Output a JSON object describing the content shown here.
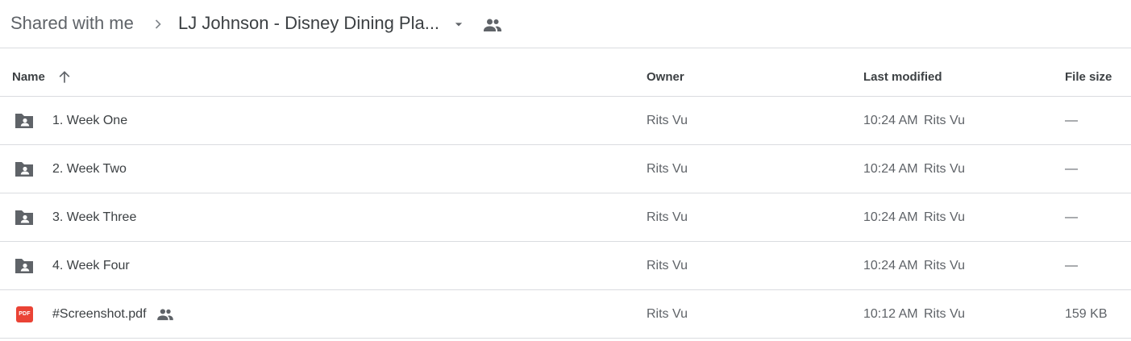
{
  "breadcrumb": {
    "root": "Shared with me",
    "current": "LJ Johnson - Disney Dining Pla..."
  },
  "table": {
    "columns": {
      "name": "Name",
      "owner": "Owner",
      "last_modified": "Last modified",
      "file_size": "File size"
    },
    "rows": [
      {
        "name": "1. Week One",
        "type": "shared-folder",
        "owner": "Rits Vu",
        "modified_time": "10:24 AM",
        "modified_by": "Rits Vu",
        "size": "—"
      },
      {
        "name": "2. Week Two",
        "type": "shared-folder",
        "owner": "Rits Vu",
        "modified_time": "10:24 AM",
        "modified_by": "Rits Vu",
        "size": "—"
      },
      {
        "name": "3. Week Three",
        "type": "shared-folder",
        "owner": "Rits Vu",
        "modified_time": "10:24 AM",
        "modified_by": "Rits Vu",
        "size": "—"
      },
      {
        "name": "4. Week Four",
        "type": "shared-folder",
        "owner": "Rits Vu",
        "modified_time": "10:24 AM",
        "modified_by": "Rits Vu",
        "size": "—"
      },
      {
        "name": "#Screenshot.pdf",
        "type": "pdf",
        "badge": "PDF",
        "owner": "Rits Vu",
        "modified_time": "10:12 AM",
        "modified_by": "Rits Vu",
        "size": "159 KB"
      }
    ]
  },
  "icons": {
    "separator": "chevron-right-icon",
    "dropdown": "arrow-drop-down-icon",
    "shared": "people-icon",
    "sort": "arrow-upward-icon",
    "folder": "shared-folder-icon",
    "pdf": "pdf-file-icon"
  },
  "colors": {
    "text": "#3c4043",
    "secondary_text": "#5f6368",
    "divider": "#dadce0",
    "folder_icon": "#5f6368",
    "pdf_red": "#ea4335"
  }
}
